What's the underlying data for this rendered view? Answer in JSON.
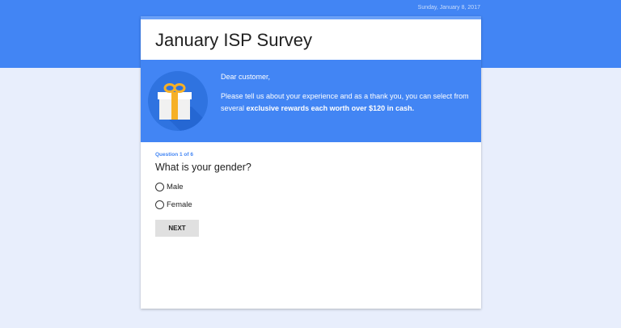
{
  "date": "Sunday, January 8, 2017",
  "survey": {
    "title": "January ISP Survey",
    "greeting": "Dear customer,",
    "message_text": "Please tell us about your experience and as a thank you, you can select from several",
    "message_bold": "exclusive rewards each worth over $120 in cash.",
    "gift_icon": "gift-icon"
  },
  "question": {
    "counter": "Question 1 of 6",
    "text": "What is your gender?",
    "options": [
      {
        "label": "Male",
        "selected": false
      },
      {
        "label": "Female",
        "selected": false
      }
    ],
    "next_label": "NEXT"
  },
  "colors": {
    "primary": "#4285f4",
    "background": "#e8eefc",
    "gift_box": "#f1f1f1",
    "gift_ribbon": "#f6b026"
  }
}
